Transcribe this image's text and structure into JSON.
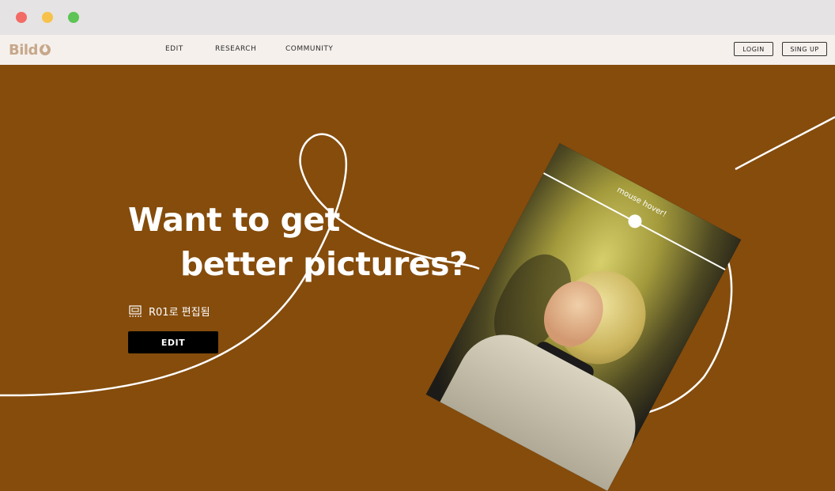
{
  "window": {
    "traffic_lights": [
      "close",
      "minimize",
      "maximize"
    ]
  },
  "navbar": {
    "logo": "Bild",
    "links": [
      "EDIT",
      "RESEARCH",
      "COMMUNITY"
    ],
    "login_label": "LOGIN",
    "signup_label": "SING UP"
  },
  "hero": {
    "title_line1": "Want to get",
    "title_line2": "better pictures?",
    "edit_info": "R01로 편집됨",
    "edit_info_icon": "monitor-icon",
    "cta_label": "EDIT",
    "photo_overlay_label": "mouse hover!",
    "colors": {
      "background": "#854c0c",
      "navbar": "#f5f0ec",
      "logo": "#c7a78a",
      "cta": "#000000"
    }
  }
}
